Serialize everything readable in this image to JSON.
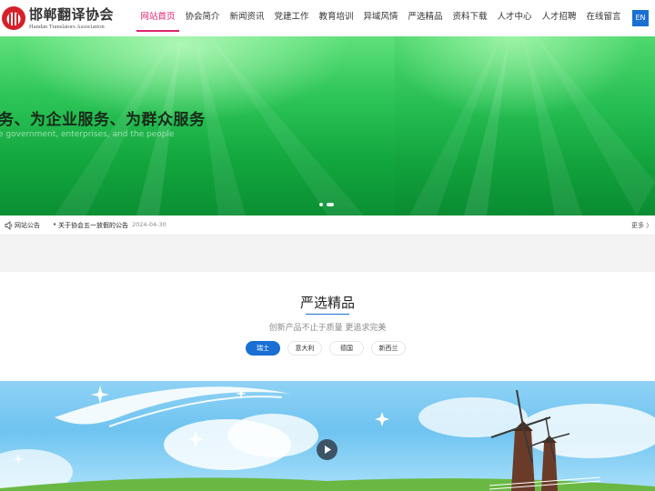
{
  "brand": {
    "name": "邯郸翻译协会",
    "name_en": "Handan Translators Association"
  },
  "nav": {
    "items": [
      {
        "label": "网站首页",
        "active": true
      },
      {
        "label": "协会简介"
      },
      {
        "label": "新闻资讯"
      },
      {
        "label": "党建工作"
      },
      {
        "label": "教育培训"
      },
      {
        "label": "异域风情"
      },
      {
        "label": "严选精品"
      },
      {
        "label": "资料下载"
      },
      {
        "label": "人才中心"
      },
      {
        "label": "人才招聘"
      },
      {
        "label": "在线留言"
      }
    ],
    "language_button": "EN"
  },
  "banner": {
    "headline": "务、为企业服务、为群众服务",
    "subtitle": "e government, enterprises, and the people",
    "slide_count": 2,
    "active_slide": 2
  },
  "notice": {
    "title": "网站公告",
    "items": [
      {
        "text": "关于协会五一放假的公告",
        "date": "2024-04-30"
      }
    ],
    "more_label": "更多 〉"
  },
  "section": {
    "title": "严选精品",
    "subtitle": "创新产品不止于质量 更追求完美",
    "tabs": [
      {
        "label": "瑞士",
        "active": true
      },
      {
        "label": "意大利"
      },
      {
        "label": "德国"
      },
      {
        "label": "新西兰"
      }
    ]
  },
  "colors": {
    "accent_nav": "#e0226d",
    "primary_blue": "#1a6fd3",
    "banner_green": "#2cc457",
    "sky_blue": "#6ec3f0"
  },
  "icons": {
    "notice": "speaker-icon",
    "play": "play-icon"
  }
}
